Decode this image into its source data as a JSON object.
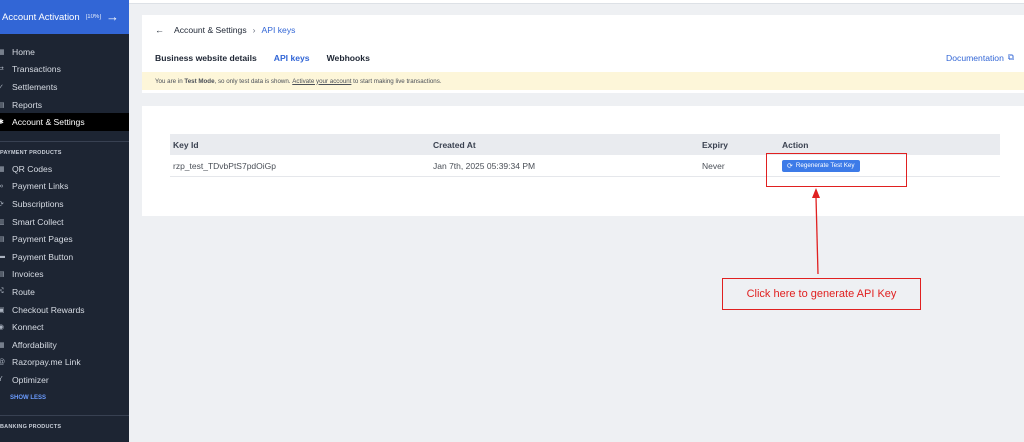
{
  "sidebar": {
    "activation": {
      "label": "Account Activation",
      "percent": "[10%]"
    },
    "items": [
      {
        "label": "Home",
        "icon": "home-icon",
        "glyph": "▦"
      },
      {
        "label": "Transactions",
        "icon": "transactions-icon",
        "glyph": "⇄"
      },
      {
        "label": "Settlements",
        "icon": "settlements-icon",
        "glyph": "✓"
      },
      {
        "label": "Reports",
        "icon": "reports-icon",
        "glyph": "▤"
      },
      {
        "label": "Account & Settings",
        "icon": "gear-icon",
        "glyph": "✱"
      }
    ],
    "payment_products_title": "PAYMENT PRODUCTS",
    "products": [
      {
        "label": "QR Codes",
        "icon": "qr-code-icon",
        "glyph": "▦"
      },
      {
        "label": "Payment Links",
        "icon": "link-icon",
        "glyph": "∞"
      },
      {
        "label": "Subscriptions",
        "icon": "subscriptions-icon",
        "glyph": "⟳"
      },
      {
        "label": "Smart Collect",
        "icon": "bank-icon",
        "glyph": "▥"
      },
      {
        "label": "Payment Pages",
        "icon": "pages-icon",
        "glyph": "▤"
      },
      {
        "label": "Payment Button",
        "icon": "button-icon",
        "glyph": "▬"
      },
      {
        "label": "Invoices",
        "icon": "invoice-icon",
        "glyph": "▤"
      },
      {
        "label": "Route",
        "icon": "route-icon",
        "glyph": "⤭"
      },
      {
        "label": "Checkout Rewards",
        "icon": "rewards-icon",
        "glyph": "▣"
      },
      {
        "label": "Konnect",
        "icon": "konnect-icon",
        "glyph": "◉"
      },
      {
        "label": "Affordability",
        "icon": "affordability-icon",
        "glyph": "▦"
      },
      {
        "label": "Razorpay.me Link",
        "icon": "at-icon",
        "glyph": "@"
      },
      {
        "label": "Optimizer",
        "icon": "optimizer-icon",
        "glyph": "Y"
      }
    ],
    "show_less": "SHOW LESS",
    "banking_products_title": "BANKING PRODUCTS"
  },
  "header": {
    "breadcrumb_parent": "Account & Settings",
    "breadcrumb_sep": "›",
    "breadcrumb_current": "API keys",
    "back_glyph": "←",
    "tabs": [
      {
        "label": "Business website details"
      },
      {
        "label": "API keys"
      },
      {
        "label": "Webhooks"
      }
    ],
    "documentation": "Documentation",
    "external_glyph": "⧉"
  },
  "notice": {
    "prefix": "You are in ",
    "mode": "Test Mode",
    "middle": ", so only test data is shown. ",
    "link": "Activate your account",
    "suffix": " to start making live transactions."
  },
  "table": {
    "headers": [
      "Key Id",
      "Created At",
      "Expiry",
      "Action"
    ],
    "rows": [
      {
        "key_id": "rzp_test_TDvbPtS7pdOiGp",
        "created_at": "Jan 7th, 2025 05:39:34 PM",
        "expiry": "Never",
        "action": "Regenerate Test Key"
      }
    ]
  },
  "annotation": {
    "label": "Click here to generate API Key",
    "color": "#e02020"
  },
  "colors": {
    "accent": "#3266d6",
    "sidebar_bg": "#1d2533",
    "notice_bg": "#fdf6d9"
  }
}
